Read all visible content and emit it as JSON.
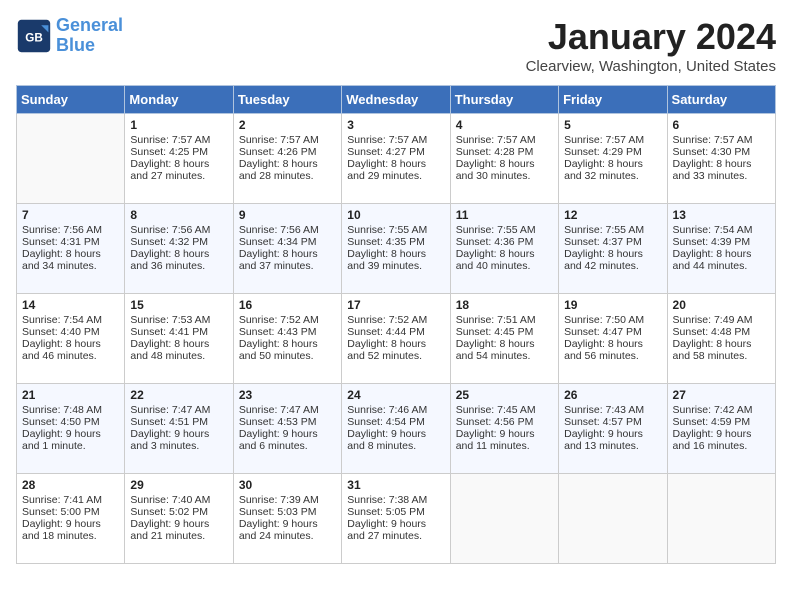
{
  "header": {
    "logo_line1": "General",
    "logo_line2": "Blue",
    "month_title": "January 2024",
    "location": "Clearview, Washington, United States"
  },
  "days_of_week": [
    "Sunday",
    "Monday",
    "Tuesday",
    "Wednesday",
    "Thursday",
    "Friday",
    "Saturday"
  ],
  "weeks": [
    [
      {
        "day": "",
        "sunrise": "",
        "sunset": "",
        "daylight": ""
      },
      {
        "day": "1",
        "sunrise": "Sunrise: 7:57 AM",
        "sunset": "Sunset: 4:25 PM",
        "daylight": "Daylight: 8 hours and 27 minutes."
      },
      {
        "day": "2",
        "sunrise": "Sunrise: 7:57 AM",
        "sunset": "Sunset: 4:26 PM",
        "daylight": "Daylight: 8 hours and 28 minutes."
      },
      {
        "day": "3",
        "sunrise": "Sunrise: 7:57 AM",
        "sunset": "Sunset: 4:27 PM",
        "daylight": "Daylight: 8 hours and 29 minutes."
      },
      {
        "day": "4",
        "sunrise": "Sunrise: 7:57 AM",
        "sunset": "Sunset: 4:28 PM",
        "daylight": "Daylight: 8 hours and 30 minutes."
      },
      {
        "day": "5",
        "sunrise": "Sunrise: 7:57 AM",
        "sunset": "Sunset: 4:29 PM",
        "daylight": "Daylight: 8 hours and 32 minutes."
      },
      {
        "day": "6",
        "sunrise": "Sunrise: 7:57 AM",
        "sunset": "Sunset: 4:30 PM",
        "daylight": "Daylight: 8 hours and 33 minutes."
      }
    ],
    [
      {
        "day": "7",
        "sunrise": "Sunrise: 7:56 AM",
        "sunset": "Sunset: 4:31 PM",
        "daylight": "Daylight: 8 hours and 34 minutes."
      },
      {
        "day": "8",
        "sunrise": "Sunrise: 7:56 AM",
        "sunset": "Sunset: 4:32 PM",
        "daylight": "Daylight: 8 hours and 36 minutes."
      },
      {
        "day": "9",
        "sunrise": "Sunrise: 7:56 AM",
        "sunset": "Sunset: 4:34 PM",
        "daylight": "Daylight: 8 hours and 37 minutes."
      },
      {
        "day": "10",
        "sunrise": "Sunrise: 7:55 AM",
        "sunset": "Sunset: 4:35 PM",
        "daylight": "Daylight: 8 hours and 39 minutes."
      },
      {
        "day": "11",
        "sunrise": "Sunrise: 7:55 AM",
        "sunset": "Sunset: 4:36 PM",
        "daylight": "Daylight: 8 hours and 40 minutes."
      },
      {
        "day": "12",
        "sunrise": "Sunrise: 7:55 AM",
        "sunset": "Sunset: 4:37 PM",
        "daylight": "Daylight: 8 hours and 42 minutes."
      },
      {
        "day": "13",
        "sunrise": "Sunrise: 7:54 AM",
        "sunset": "Sunset: 4:39 PM",
        "daylight": "Daylight: 8 hours and 44 minutes."
      }
    ],
    [
      {
        "day": "14",
        "sunrise": "Sunrise: 7:54 AM",
        "sunset": "Sunset: 4:40 PM",
        "daylight": "Daylight: 8 hours and 46 minutes."
      },
      {
        "day": "15",
        "sunrise": "Sunrise: 7:53 AM",
        "sunset": "Sunset: 4:41 PM",
        "daylight": "Daylight: 8 hours and 48 minutes."
      },
      {
        "day": "16",
        "sunrise": "Sunrise: 7:52 AM",
        "sunset": "Sunset: 4:43 PM",
        "daylight": "Daylight: 8 hours and 50 minutes."
      },
      {
        "day": "17",
        "sunrise": "Sunrise: 7:52 AM",
        "sunset": "Sunset: 4:44 PM",
        "daylight": "Daylight: 8 hours and 52 minutes."
      },
      {
        "day": "18",
        "sunrise": "Sunrise: 7:51 AM",
        "sunset": "Sunset: 4:45 PM",
        "daylight": "Daylight: 8 hours and 54 minutes."
      },
      {
        "day": "19",
        "sunrise": "Sunrise: 7:50 AM",
        "sunset": "Sunset: 4:47 PM",
        "daylight": "Daylight: 8 hours and 56 minutes."
      },
      {
        "day": "20",
        "sunrise": "Sunrise: 7:49 AM",
        "sunset": "Sunset: 4:48 PM",
        "daylight": "Daylight: 8 hours and 58 minutes."
      }
    ],
    [
      {
        "day": "21",
        "sunrise": "Sunrise: 7:48 AM",
        "sunset": "Sunset: 4:50 PM",
        "daylight": "Daylight: 9 hours and 1 minute."
      },
      {
        "day": "22",
        "sunrise": "Sunrise: 7:47 AM",
        "sunset": "Sunset: 4:51 PM",
        "daylight": "Daylight: 9 hours and 3 minutes."
      },
      {
        "day": "23",
        "sunrise": "Sunrise: 7:47 AM",
        "sunset": "Sunset: 4:53 PM",
        "daylight": "Daylight: 9 hours and 6 minutes."
      },
      {
        "day": "24",
        "sunrise": "Sunrise: 7:46 AM",
        "sunset": "Sunset: 4:54 PM",
        "daylight": "Daylight: 9 hours and 8 minutes."
      },
      {
        "day": "25",
        "sunrise": "Sunrise: 7:45 AM",
        "sunset": "Sunset: 4:56 PM",
        "daylight": "Daylight: 9 hours and 11 minutes."
      },
      {
        "day": "26",
        "sunrise": "Sunrise: 7:43 AM",
        "sunset": "Sunset: 4:57 PM",
        "daylight": "Daylight: 9 hours and 13 minutes."
      },
      {
        "day": "27",
        "sunrise": "Sunrise: 7:42 AM",
        "sunset": "Sunset: 4:59 PM",
        "daylight": "Daylight: 9 hours and 16 minutes."
      }
    ],
    [
      {
        "day": "28",
        "sunrise": "Sunrise: 7:41 AM",
        "sunset": "Sunset: 5:00 PM",
        "daylight": "Daylight: 9 hours and 18 minutes."
      },
      {
        "day": "29",
        "sunrise": "Sunrise: 7:40 AM",
        "sunset": "Sunset: 5:02 PM",
        "daylight": "Daylight: 9 hours and 21 minutes."
      },
      {
        "day": "30",
        "sunrise": "Sunrise: 7:39 AM",
        "sunset": "Sunset: 5:03 PM",
        "daylight": "Daylight: 9 hours and 24 minutes."
      },
      {
        "day": "31",
        "sunrise": "Sunrise: 7:38 AM",
        "sunset": "Sunset: 5:05 PM",
        "daylight": "Daylight: 9 hours and 27 minutes."
      },
      {
        "day": "",
        "sunrise": "",
        "sunset": "",
        "daylight": ""
      },
      {
        "day": "",
        "sunrise": "",
        "sunset": "",
        "daylight": ""
      },
      {
        "day": "",
        "sunrise": "",
        "sunset": "",
        "daylight": ""
      }
    ]
  ]
}
